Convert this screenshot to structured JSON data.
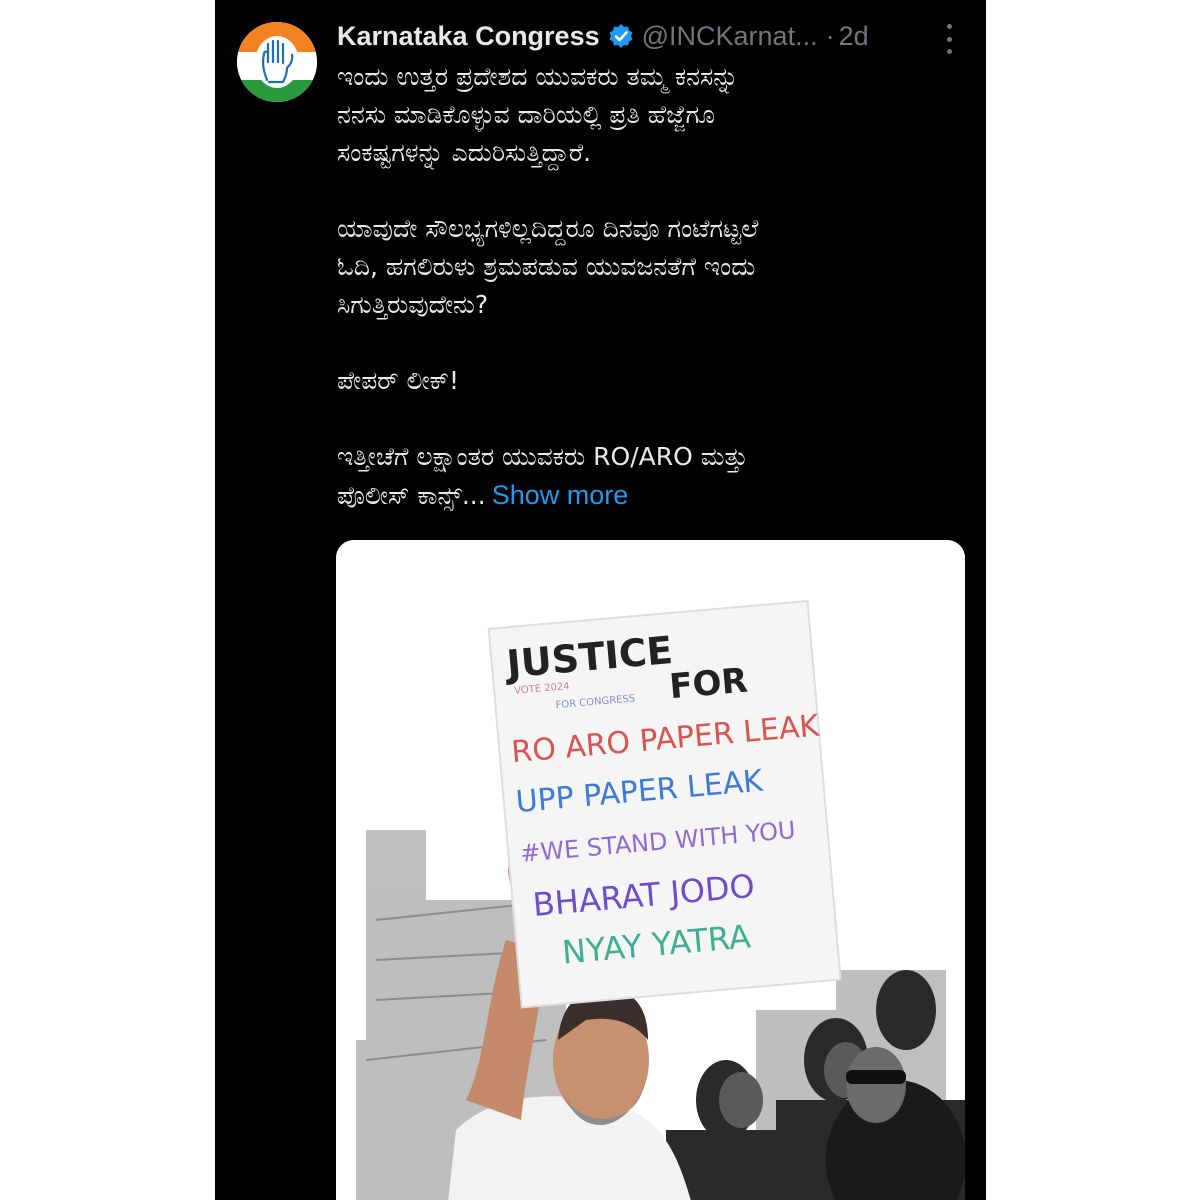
{
  "tweet": {
    "display_name": "Karnataka Congress",
    "handle": "@INCKarnat...",
    "separator": "·",
    "time": "2d",
    "lines": [
      "ಇಂದು ಉತ್ತರ ಪ್ರದೇಶದ ಯುವಕರು ತಮ್ಮ ಕನಸನ್ನು",
      "ನನಸು ಮಾಡಿಕೊಳ್ಳುವ ದಾರಿಯಲ್ಲಿ ಪ್ರತಿ ಹೆಜ್ಜೆಗೂ",
      "ಸಂಕಷ್ಟಗಳನ್ನು ಎದುರಿಸುತ್ತಿದ್ದಾರೆ.",
      "ಯಾವುದೇ ಸೌಲಭ್ಯಗಳಿಲ್ಲದಿದ್ದರೂ ದಿನವೂ ಗಂಟೆಗಟ್ಟಲೆ",
      "ಓದಿ, ಹಗಲಿರುಳು ಶ್ರಮಪಡುವ ಯುವಜನತೆಗೆ ಇಂದು",
      "ಸಿಗುತ್ತಿರುವುದೇನು?",
      "ಪೇಪರ್ ಲೀಕ್!",
      "ಇತ್ತೀಚೆಗೆ ಲಕ್ಷಾಂತರ ಯುವಕರು RO/ARO ಮತ್ತು",
      "ಪೊಲೀಸ್ ಕಾನ್ಸ್..."
    ],
    "show_more": "Show more"
  },
  "image": {
    "sign_lines": [
      "JUSTICE",
      "FOR",
      "RO ARO PAPER LEAK",
      "UPP PAPER LEAK",
      "#WE STAND WITH YOU",
      "BHARAT JODO",
      "NYAY YATRA"
    ],
    "sign_small": [
      "VOTE 2024",
      "FOR CONGRESS"
    ]
  },
  "colors": {
    "background": "#000000",
    "text": "#e7e9ea",
    "muted": "#71767b",
    "link": "#1d9bf0",
    "verified": "#1d9bf0"
  },
  "icons": {
    "verified": "verified-badge-icon",
    "more": "more-options-icon"
  }
}
